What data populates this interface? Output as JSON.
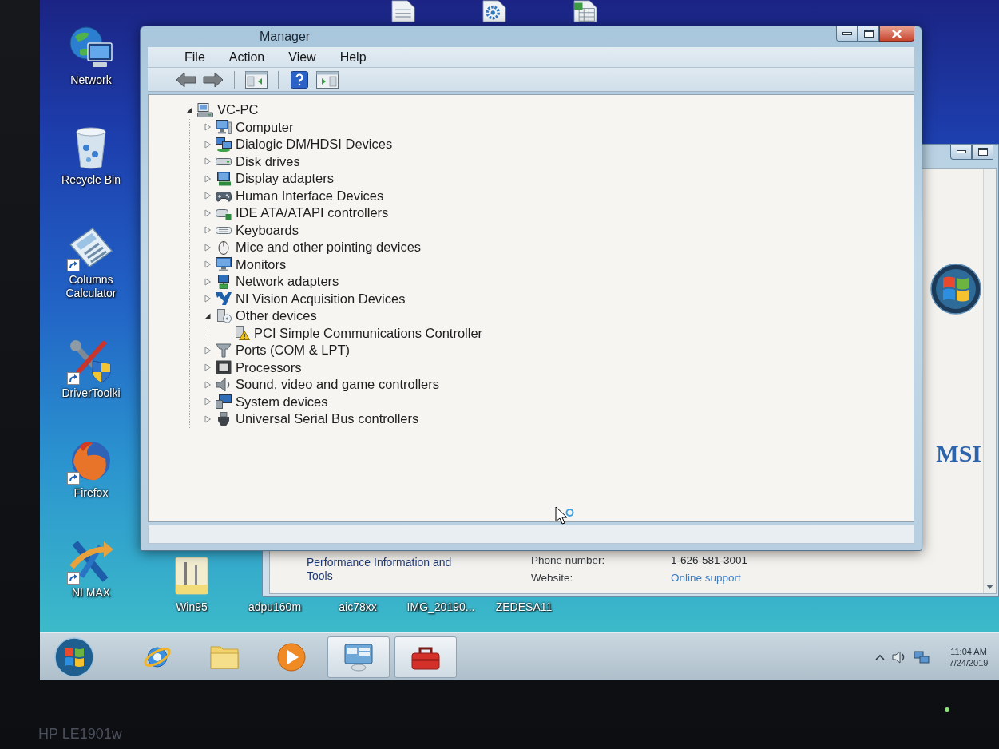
{
  "desktop": {
    "top_icons": [
      {
        "kind": "document"
      },
      {
        "kind": "settings_file"
      },
      {
        "kind": "spreadsheet_file"
      }
    ],
    "icons": [
      {
        "label": "Network",
        "kind": "network",
        "shortcut": false
      },
      {
        "label": "Recycle Bin",
        "kind": "recycle_bin",
        "shortcut": false
      },
      {
        "label": "Columns Calculator",
        "kind": "calculator",
        "shortcut": true
      },
      {
        "label": "DriverToolki",
        "kind": "toolkit",
        "shortcut": true
      },
      {
        "label": "Firefox",
        "kind": "browser",
        "shortcut": true
      },
      {
        "label": "NI MAX",
        "kind": "ni_max",
        "shortcut": true
      }
    ],
    "bottom_icons": [
      {
        "label": "Win95",
        "kind": "file"
      },
      {
        "label": "adpu160m",
        "kind": "covered"
      },
      {
        "label": "aic78xx",
        "kind": "covered"
      },
      {
        "label": "IMG_20190...",
        "kind": "covered"
      },
      {
        "label": "ZEDESA11",
        "kind": "covered"
      }
    ]
  },
  "device_manager": {
    "title": "Manager",
    "menu": [
      "File",
      "Action",
      "View",
      "Help"
    ],
    "toolbar": [
      [
        {
          "kind": "back",
          "disabled": true
        },
        {
          "kind": "forward",
          "disabled": true
        }
      ],
      [
        {
          "kind": "console_tree",
          "disabled": false
        }
      ],
      [
        {
          "kind": "help",
          "disabled": false
        },
        {
          "kind": "action_pane",
          "disabled": false
        }
      ]
    ],
    "tree": [
      {
        "label": "VC-PC",
        "kind": "computer",
        "expanded": true,
        "children": [
          {
            "label": "Computer",
            "kind": "pc",
            "expanded": false
          },
          {
            "label": "Dialogic DM/HDSI Devices",
            "kind": "dialogic",
            "expanded": false
          },
          {
            "label": "Disk drives",
            "kind": "disk",
            "expanded": false
          },
          {
            "label": "Display adapters",
            "kind": "display",
            "expanded": false
          },
          {
            "label": "Human Interface Devices",
            "kind": "hid",
            "expanded": false
          },
          {
            "label": "IDE ATA/ATAPI controllers",
            "kind": "ide",
            "expanded": false
          },
          {
            "label": "Keyboards",
            "kind": "keyboard",
            "expanded": false
          },
          {
            "label": "Mice and other pointing devices",
            "kind": "mouse",
            "expanded": false
          },
          {
            "label": "Monitors",
            "kind": "monitor",
            "expanded": false
          },
          {
            "label": "Network adapters",
            "kind": "network",
            "expanded": false
          },
          {
            "label": "NI Vision Acquisition Devices",
            "kind": "vision",
            "expanded": false
          },
          {
            "label": "Other devices",
            "kind": "other",
            "expanded": true,
            "children": [
              {
                "label": "PCI Simple Communications Controller",
                "kind": "warning"
              }
            ]
          },
          {
            "label": "Ports (COM & LPT)",
            "kind": "port",
            "expanded": false
          },
          {
            "label": "Processors",
            "kind": "processor",
            "expanded": false
          },
          {
            "label": "Sound, video and game controllers",
            "kind": "sound",
            "expanded": false
          },
          {
            "label": "System devices",
            "kind": "system",
            "expanded": false
          },
          {
            "label": "Universal Serial Bus controllers",
            "kind": "usb",
            "expanded": false
          }
        ]
      }
    ]
  },
  "system_window": {
    "sidebar_link": "Performance Information and Tools",
    "oem_logo": "MSI",
    "support": [
      {
        "label": "Phone number:",
        "value": "1-626-581-3001",
        "kind": "text"
      },
      {
        "label": "Website:",
        "value": "Online support",
        "kind": "link"
      }
    ]
  },
  "taskbar": {
    "items": [
      {
        "kind": "browser",
        "running": false
      },
      {
        "kind": "folder",
        "running": false
      },
      {
        "kind": "media",
        "running": false
      },
      {
        "kind": "control_panel",
        "running": true
      },
      {
        "kind": "toolbox",
        "running": true
      }
    ],
    "tray": [
      {
        "kind": "chevron"
      },
      {
        "kind": "volume"
      },
      {
        "kind": "network"
      }
    ],
    "time": "11:04 AM",
    "date": "7/24/2019"
  },
  "monitor": {
    "model": "HP LE1901w"
  }
}
